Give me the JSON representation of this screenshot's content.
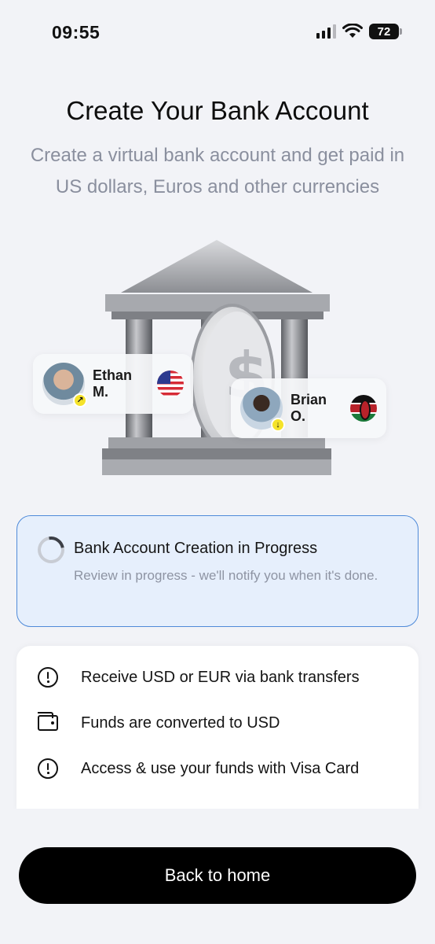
{
  "status_bar": {
    "time": "09:55",
    "battery": "72",
    "icons": [
      "cellular-signal-icon",
      "wifi-icon",
      "battery-icon"
    ]
  },
  "header": {
    "title": "Create Your Bank Account",
    "subtitle": "Create a virtual bank account and get paid in US dollars, Euros and other currencies"
  },
  "illustration": {
    "users": [
      {
        "name": "Ethan M.",
        "flag": "US",
        "direction": "outgoing-arrow-icon"
      },
      {
        "name": "Brian O.",
        "flag": "KE",
        "direction": "incoming-arrow-icon"
      }
    ]
  },
  "progress": {
    "title": "Bank Account Creation in Progress",
    "description": "Review in progress - we'll notify you when it's done."
  },
  "features": [
    {
      "icon": "alert-circle-icon",
      "label": "Receive USD or EUR via bank transfers"
    },
    {
      "icon": "wallet-icon",
      "label": "Funds are converted to USD"
    },
    {
      "icon": "alert-circle-icon",
      "label": "Access & use your funds with Visa Card"
    }
  ],
  "actions": {
    "back_home": "Back to home"
  },
  "colors": {
    "background": "#f2f3f7",
    "progress_bg": "#e6effc",
    "progress_border": "#4f8ad9",
    "button_bg": "#000000",
    "subtitle": "#8a8f9e"
  }
}
